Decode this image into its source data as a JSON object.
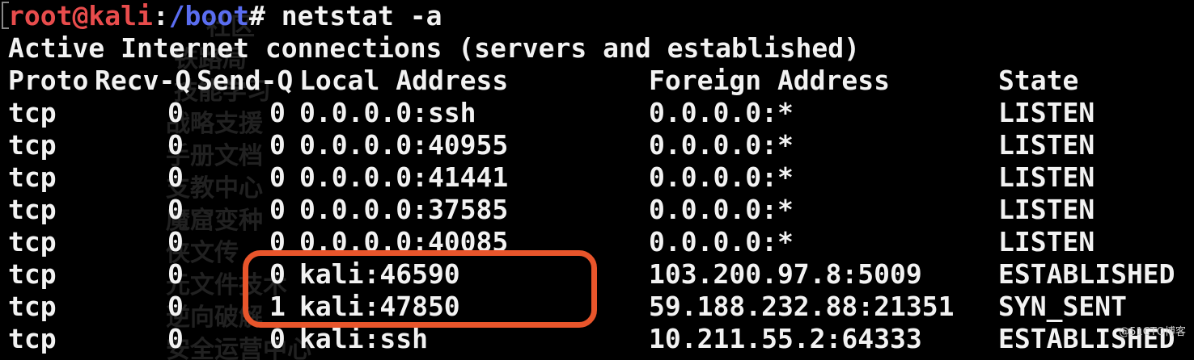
{
  "terminal": {
    "prompt": {
      "user_host": "root@kali",
      "separator": ":",
      "path": "/boot",
      "symbol": "#",
      "command": " netstat -a"
    },
    "header_line": "Active Internet connections (servers and established)",
    "columns": {
      "proto": "Proto",
      "recvq": "Recv-Q",
      "sendq": "Send-Q",
      "local": "Local Address",
      "foreign": "Foreign Address",
      "state": "State"
    },
    "rows": [
      {
        "proto": "tcp",
        "recvq": "0",
        "sendq": "0",
        "local": "0.0.0.0:ssh",
        "foreign": "0.0.0.0:*",
        "state": "LISTEN"
      },
      {
        "proto": "tcp",
        "recvq": "0",
        "sendq": "0",
        "local": "0.0.0.0:40955",
        "foreign": "0.0.0.0:*",
        "state": "LISTEN"
      },
      {
        "proto": "tcp",
        "recvq": "0",
        "sendq": "0",
        "local": "0.0.0.0:41441",
        "foreign": "0.0.0.0:*",
        "state": "LISTEN"
      },
      {
        "proto": "tcp",
        "recvq": "0",
        "sendq": "0",
        "local": "0.0.0.0:37585",
        "foreign": "0.0.0.0:*",
        "state": "LISTEN"
      },
      {
        "proto": "tcp",
        "recvq": "0",
        "sendq": "0",
        "local": "0.0.0.0:40085",
        "foreign": "0.0.0.0:*",
        "state": "LISTEN"
      },
      {
        "proto": "tcp",
        "recvq": "0",
        "sendq": "0",
        "local": "kali:46590",
        "foreign": "103.200.97.8:5009",
        "state": "ESTABLISHED"
      },
      {
        "proto": "tcp",
        "recvq": "0",
        "sendq": "1",
        "local": "kali:47850",
        "foreign": "59.188.232.88:21351",
        "state": "SYN_SENT"
      },
      {
        "proto": "tcp",
        "recvq": "0",
        "sendq": "0",
        "local": "kali:ssh",
        "foreign": "10.211.55.2:64333",
        "state": "ESTABLISHED"
      }
    ]
  },
  "watermark": {
    "lines": [
      "社区",
      "铁路局",
      "技能学习",
      "战略支援",
      "手册文档",
      "支教中心",
      "魔窟变种",
      "侠文传",
      "元文件技术",
      "逆向破解",
      "安全运营中心"
    ]
  },
  "badge": {
    "text": "@51CTO博客"
  },
  "colors": {
    "background": "#000000",
    "text": "#f2f2f2",
    "prompt_user": "#e84c4c",
    "prompt_path": "#5a6df0",
    "highlight": "#e8552b"
  }
}
